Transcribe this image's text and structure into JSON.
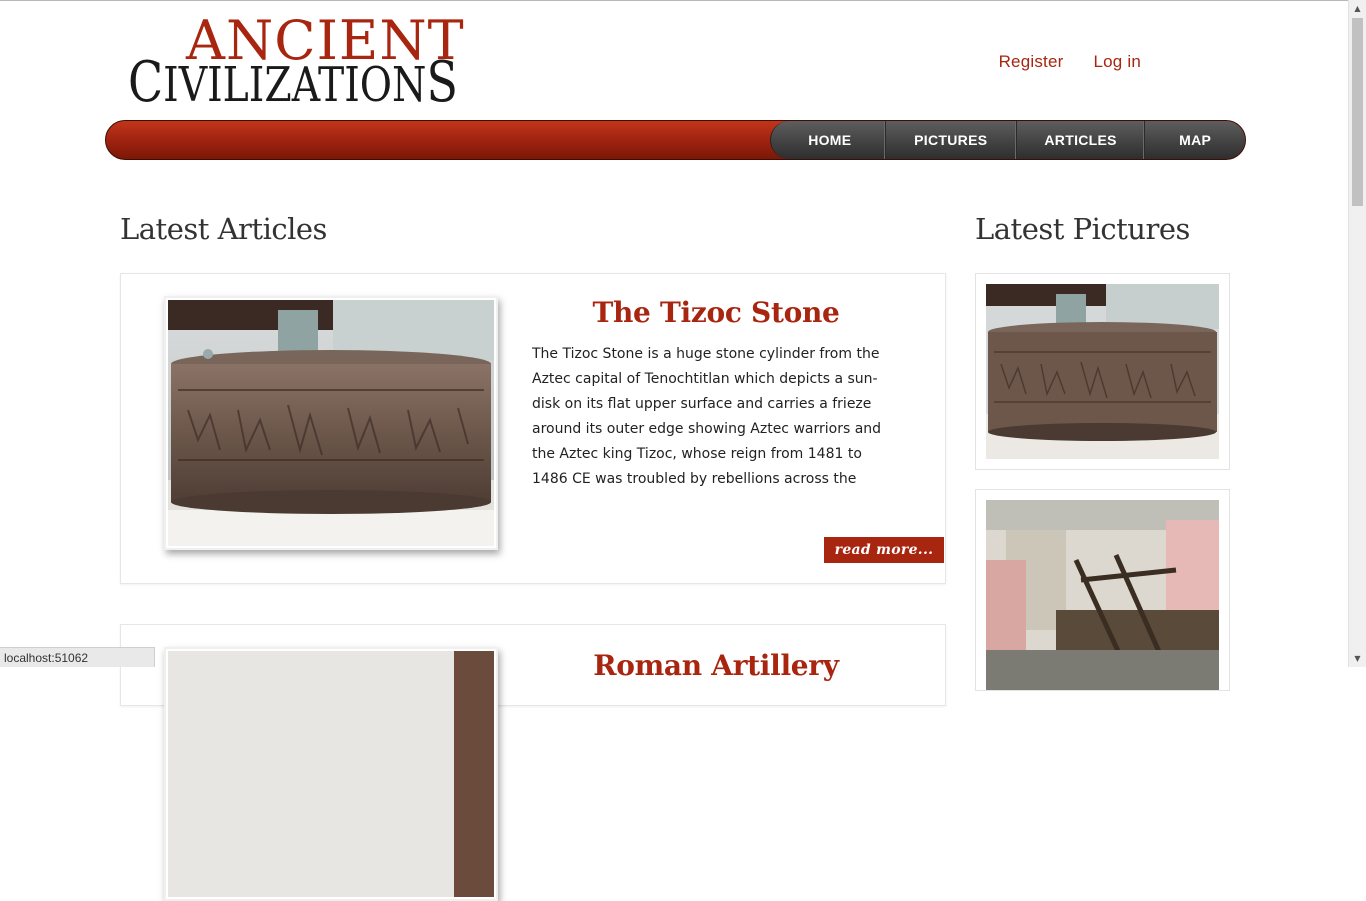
{
  "brand": {
    "line1": "ANCIENT",
    "line2_first": "C",
    "line2_mid": "IVILIZATION",
    "line2_last": "S"
  },
  "user_links": {
    "register": "Register",
    "login": "Log in"
  },
  "nav": {
    "home": "HOME",
    "pictures": "PICTURES",
    "articles": "ARTICLES",
    "map": "MAP"
  },
  "latest_articles": {
    "title": "Latest Articles",
    "items": [
      {
        "title": "The Tizoc Stone",
        "excerpt": "The Tizoc Stone is a huge stone cylinder from the Aztec capital of Tenochtitlan which depicts a sun-disk on its flat upper surface and carries a frieze around its outer edge showing Aztec warriors and the Aztec king Tizoc, whose reign from 1481 to 1486 CE was troubled by rebellions across the empire. The stone was almost certainly used",
        "read_more": "read more..."
      },
      {
        "title": "Roman Artillery"
      }
    ]
  },
  "latest_pictures": {
    "title": "Latest Pictures"
  },
  "status_bar": {
    "url": "localhost:51062"
  },
  "colors": {
    "brand_red": "#a8250f",
    "nav_dark": "#454545",
    "nav_red": "#a32511"
  }
}
